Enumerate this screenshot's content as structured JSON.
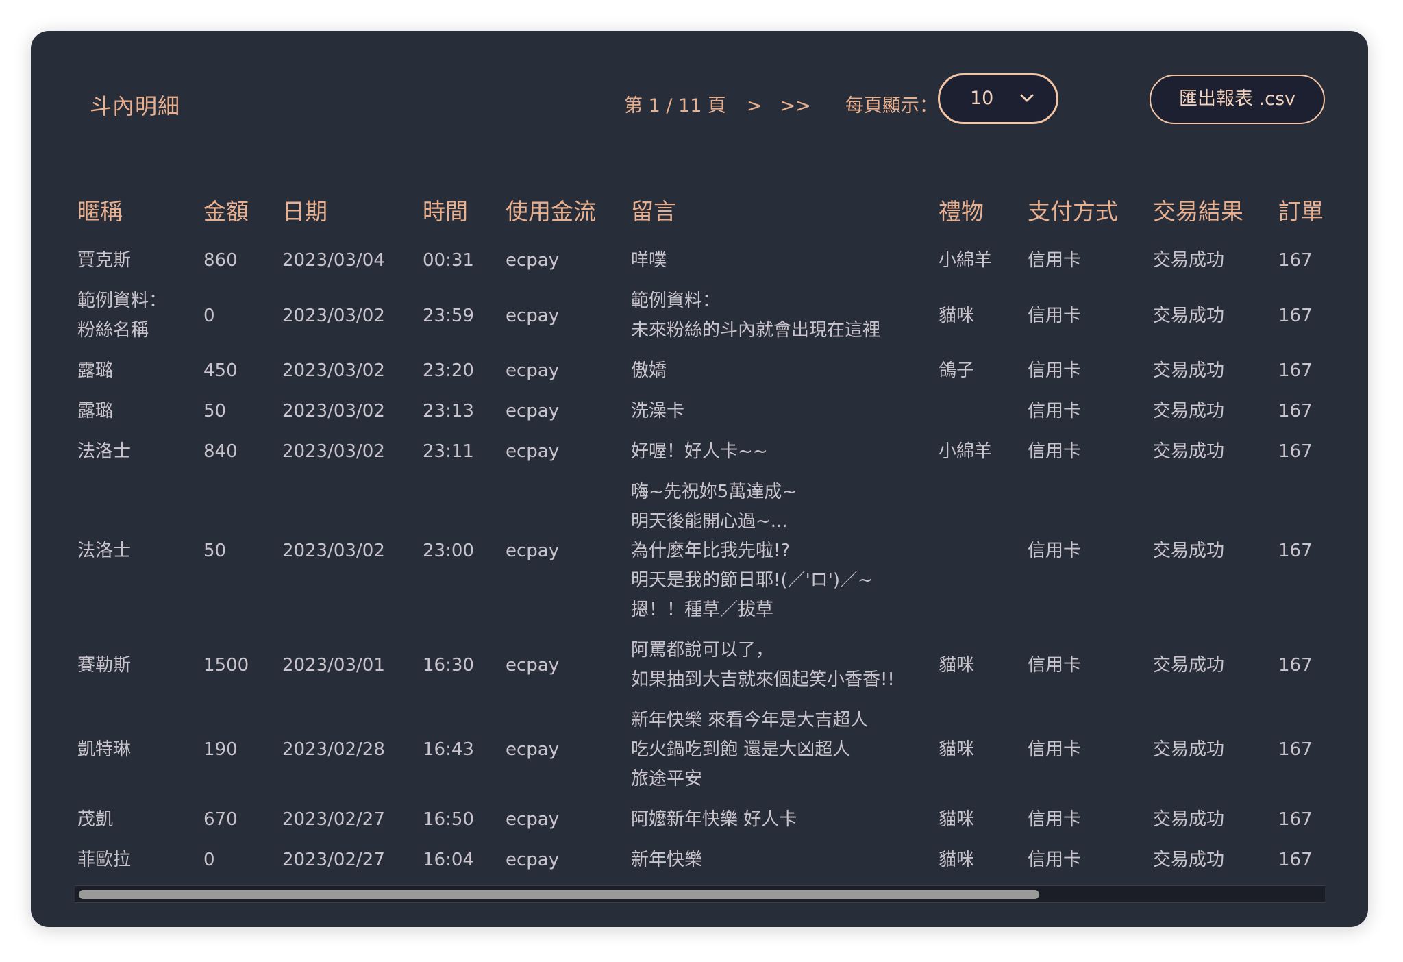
{
  "panel": {
    "title": "斗內明細"
  },
  "pagination": {
    "page_text": "第 1 / 11 頁",
    "next": ">",
    "last": ">>",
    "per_page_label": "每頁顯示：",
    "per_page_value": "10"
  },
  "export": {
    "label": "匯出報表 .csv"
  },
  "table": {
    "headers": [
      "暱稱",
      "金額",
      "日期",
      "時間",
      "使用金流",
      "留言",
      "禮物",
      "支付方式",
      "交易結果",
      "訂單"
    ],
    "rows": [
      [
        "賈克斯",
        "860",
        "2023/03/04",
        "00:31",
        "ecpay",
        "咩噗",
        "小綿羊",
        "信用卡",
        "交易成功",
        "167"
      ],
      [
        "範例資料：\n粉絲名稱",
        "0",
        "2023/03/02",
        "23:59",
        "ecpay",
        "範例資料：\n未來粉絲的斗內就會出現在這裡",
        "貓咪",
        "信用卡",
        "交易成功",
        "167"
      ],
      [
        "露璐",
        "450",
        "2023/03/02",
        "23:20",
        "ecpay",
        "傲嬌",
        "鴿子",
        "信用卡",
        "交易成功",
        "167"
      ],
      [
        "露璐",
        "50",
        "2023/03/02",
        "23:13",
        "ecpay",
        "洗澡卡",
        "",
        "信用卡",
        "交易成功",
        "167"
      ],
      [
        "法洛士",
        "840",
        "2023/03/02",
        "23:11",
        "ecpay",
        "好喔！好人卡~~",
        "小綿羊",
        "信用卡",
        "交易成功",
        "167"
      ],
      [
        "法洛士",
        "50",
        "2023/03/02",
        "23:00",
        "ecpay",
        "嗨~先祝妳5萬達成~\n明天後能開心過~...\n為什麼年比我先啦!?\n明天是我的節日耶!(／'ロ')／~\n摁！！種草／拔草",
        "",
        "信用卡",
        "交易成功",
        "167"
      ],
      [
        "賽勒斯",
        "1500",
        "2023/03/01",
        "16:30",
        "ecpay",
        "阿罵都說可以了，\n如果抽到大吉就來個起笑小香香!!",
        "貓咪",
        "信用卡",
        "交易成功",
        "167"
      ],
      [
        "凱特琳",
        "190",
        "2023/02/28",
        "16:43",
        "ecpay",
        "新年快樂 來看今年是大吉超人\n吃火鍋吃到飽 還是大凶超人\n旅途平安",
        "貓咪",
        "信用卡",
        "交易成功",
        "167"
      ],
      [
        "茂凱",
        "670",
        "2023/02/27",
        "16:50",
        "ecpay",
        "阿嬤新年快樂 好人卡",
        "貓咪",
        "信用卡",
        "交易成功",
        "167"
      ],
      [
        "菲歐拉",
        "0",
        "2023/02/27",
        "16:04",
        "ecpay",
        "新年快樂",
        "貓咪",
        "信用卡",
        "交易成功",
        "167"
      ]
    ]
  },
  "scrollbar": {
    "position_fraction": 0.77
  },
  "colors": {
    "panel_bg": "#282d3a",
    "accent": "#e8b08e",
    "text": "#c9c4cc",
    "control_bg": "#1c2030"
  },
  "icons": {
    "dropdown": "chevron-down-icon"
  }
}
